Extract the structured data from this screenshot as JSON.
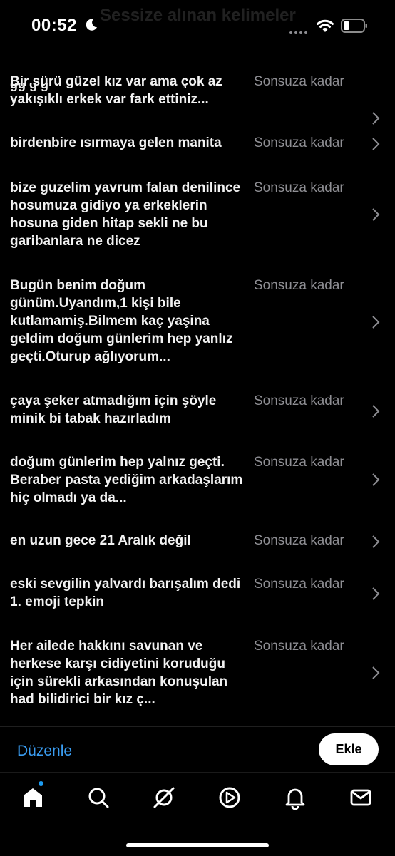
{
  "statusbar": {
    "time": "00:52",
    "ghost_title": "Sessize alınan kelimeler"
  },
  "list": {
    "peek_text": "gg g g",
    "items": [
      {
        "text": "Bir sürü güzel kız var ama çok az yakışıklı erkek var fark ettiniz...",
        "expiry": "Sonsuza kadar"
      },
      {
        "text": "birdenbire ısırmaya gelen manita",
        "expiry": "Sonsuza kadar"
      },
      {
        "text": "bize guzelim yavrum falan denilince hosumuza gidiyo ya erkeklerin hosuna giden hitap sekli ne bu garibanlara ne dicez",
        "expiry": "Sonsuza kadar"
      },
      {
        "text": "Bugün benim doğum günüm.Uyandım,1 kişi bile kutlamamiş.Bilmem kaç yaşina geldim doğum günlerim hep yanlız geçti.Oturup ağlıyorum...",
        "expiry": "Sonsuza kadar"
      },
      {
        "text": "çaya şeker atmadığım için şöyle minik bi tabak hazırladım",
        "expiry": "Sonsuza kadar"
      },
      {
        "text": "doğum günlerim hep yalnız geçti. Beraber pasta yediğim arkadaşlarım hiç olmadı ya da...",
        "expiry": "Sonsuza kadar"
      },
      {
        "text": "en uzun gece 21 Aralık değil",
        "expiry": "Sonsuza kadar"
      },
      {
        "text": "eski sevgilin yalvardı barışalım dedi 1. emoji tepkin",
        "expiry": "Sonsuza kadar"
      },
      {
        "text": "Her ailede hakkını savunan ve herkese karşı cidiyetini koruduğu için sürekli arkasından konuşulan had bilidirici bir kız ç...",
        "expiry": "Sonsuza kadar"
      }
    ]
  },
  "actions": {
    "edit_label": "Düzenle",
    "add_label": "Ekle"
  },
  "tabbar": {
    "items": [
      "home-icon",
      "search-icon",
      "grok-icon",
      "video-icon",
      "notifications-icon",
      "messages-icon"
    ],
    "active": "home-icon"
  },
  "colors": {
    "background": "#000000",
    "accent": "#1d9bf0",
    "muted": "#8e8e93"
  }
}
